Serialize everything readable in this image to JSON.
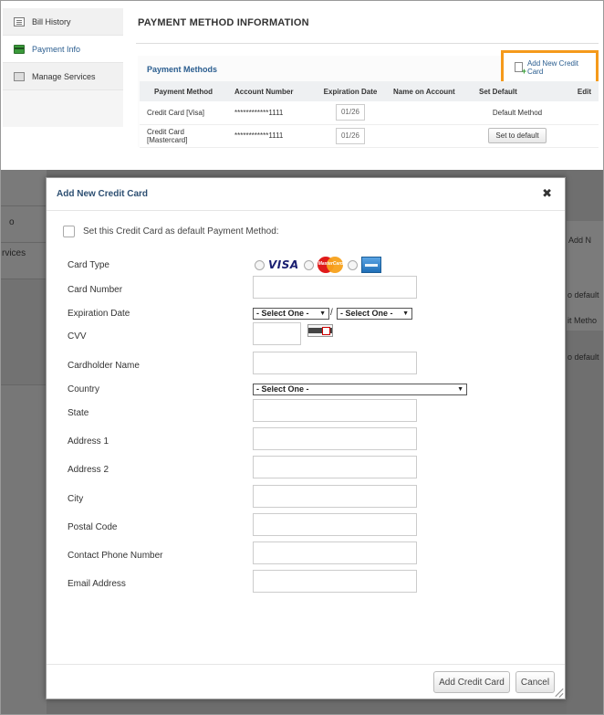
{
  "sidebar": {
    "items": [
      {
        "label": "Bill History",
        "icon": "bill-history-icon"
      },
      {
        "label": "Payment Info",
        "icon": "payment-card-icon"
      },
      {
        "label": "Manage Services",
        "icon": "services-icon"
      }
    ]
  },
  "main": {
    "title": "PAYMENT METHOD INFORMATION",
    "payment_methods_label": "Payment Methods",
    "add_new_credit_card_link": "Add New Credit Card",
    "highlight_color": "#f59a1b",
    "table": {
      "columns": [
        "Payment Method",
        "Account Number",
        "Expiration Date",
        "Name on Account",
        "Set Default",
        "Edit"
      ],
      "rows": [
        {
          "method": "Credit Card [Visa]",
          "account": "************1111",
          "expiration": "01/26",
          "name": "",
          "default": "Default Method"
        },
        {
          "method": "Credit Card [Mastercard]",
          "account": "************1111",
          "expiration": "01/26",
          "name": "",
          "default_button": "Set to default"
        }
      ]
    }
  },
  "background": {
    "left_fragment_1": "o",
    "left_fragment_2": "rvices",
    "right_fragment_1": "Add N",
    "right_fragment_2": "o default",
    "right_fragment_3": "it Metho",
    "right_fragment_4": "o default"
  },
  "modal": {
    "title": "Add New Credit Card",
    "close_glyph": "✖",
    "default_checkbox_label": "Set this Credit Card as default Payment Method:",
    "fields": {
      "card_type": "Card Type",
      "card_number": "Card Number",
      "expiration_date": "Expiration Date",
      "cvv": "CVV",
      "cardholder_name": "Cardholder Name",
      "country": "Country",
      "state": "State",
      "address1": "Address 1",
      "address2": "Address 2",
      "city": "City",
      "postal_code": "Postal Code",
      "phone": "Contact Phone Number",
      "email": "Email Address"
    },
    "card_types": [
      "VISA",
      "MasterCard",
      "American Express"
    ],
    "visa_text": "VISA",
    "mastercard_text": "MasterCard",
    "exp_month_select": "- Select One -",
    "exp_separator": "/",
    "exp_year_select": "- Select One -",
    "country_select": "- Select One -",
    "buttons": {
      "add": "Add Credit Card",
      "cancel": "Cancel"
    }
  }
}
